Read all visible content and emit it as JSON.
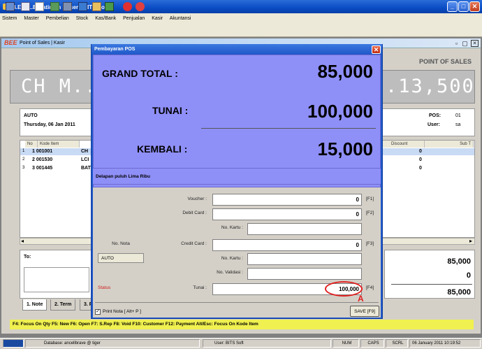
{
  "window": {
    "title": "B.E.E 1.8 Platinum [ User : BITS Soft ]",
    "min": "_",
    "max": "□",
    "close": "✕"
  },
  "menu": [
    "Sistem",
    "Master",
    "Pembelian",
    "Stock",
    "Kas/Bank",
    "Penjualan",
    "Kasir",
    "Akuntansi"
  ],
  "child": {
    "logo": "BEE",
    "title": "Point of Sales | Kasir",
    "header_label": "POINT OF SALES",
    "big_left": "CH M..",
    "big_right": ".13,500",
    "customer": "AUTO",
    "date": "Thursday, 06 Jan 2011",
    "pos_label": "POS:",
    "pos_value": "01",
    "user_label": "User:",
    "user_value": "sa"
  },
  "grid": {
    "headers": {
      "no": "No",
      "kode": "Kode Item",
      "discount": "Discount",
      "subtotal": "Sub T"
    },
    "rows": [
      {
        "no": "1",
        "kode": "1 001001",
        "name": "CH",
        "discount": "0"
      },
      {
        "no": "2",
        "kode": "2 001530",
        "name": "LCI",
        "discount": "0"
      },
      {
        "no": "3",
        "kode": "3 001445",
        "name": "BAT",
        "discount": "0"
      }
    ]
  },
  "bottom": {
    "to_label": "To:",
    "totals": [
      "85,000",
      "0",
      "85,000"
    ],
    "tabs": [
      "1. Note",
      "2. Term",
      "3. Pay"
    ]
  },
  "function_bar": "F4: Focus On Qty   F5: New   F6: Open   F7: S.Rep   F8: Void   F10: Customer   F12: Payment   Alt/Esc: Focus On Kode Item",
  "status_bar": {
    "database": "Database: ancellbrave @ tiger",
    "user": "User: BITS Soft",
    "num": "NUM",
    "caps": "CAPS",
    "scrl": "SCRL",
    "datetime": "06 January 2011  10:19:52"
  },
  "dialog": {
    "title": "Pembayaran POS",
    "grand_total_label": "GRAND TOTAL :",
    "grand_total_value": "85,000",
    "tunai_label": "TUNAI :",
    "tunai_value": "100,000",
    "kembali_label": "KEMBALI :",
    "kembali_value": "15,000",
    "in_words": "Delapan puluh Lima Ribu",
    "voucher_label": "Voucher :",
    "voucher_value": "0",
    "voucher_key": "[F1]",
    "debit_label": "Debit Card :",
    "debit_value": "0",
    "debit_key": "[F2]",
    "no_kartu_label": "No. Kartu :",
    "no_nota_label": "No. Nota",
    "nota_value": "AUTO",
    "credit_label": "Credit Card :",
    "credit_value": "0",
    "credit_key": "[F3]",
    "no_kartu2_label": "No. Kartu :",
    "no_validasi_label": "No. Validasi :",
    "status_label": "Status",
    "tunai_field_label": "Tunai :",
    "tunai_field_value": "100,000",
    "tunai_key": "[F4]",
    "annotation": "A",
    "print_label": "Print Nota [ Alt+ P ]",
    "save_label": "SAVE [F9]"
  }
}
